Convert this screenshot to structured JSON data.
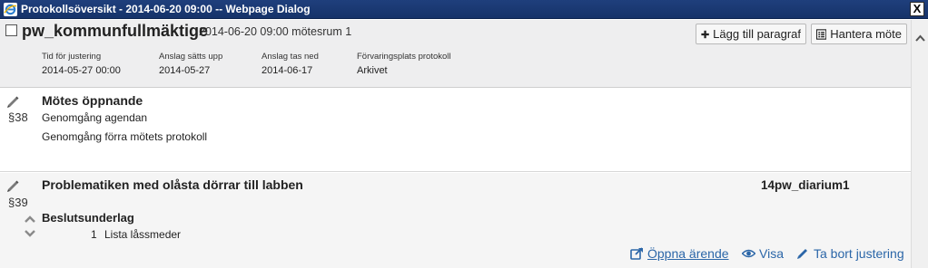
{
  "window": {
    "title": "Protokollsöversikt - 2014-06-20 09:00 -- Webpage Dialog",
    "close_label": "X"
  },
  "header": {
    "title": "pw_kommunfullmäktige",
    "subtitle": "2014-06-20 09:00 mötesrum 1",
    "buttons": {
      "add_paragraph": "Lägg till paragraf",
      "manage_meeting": "Hantera möte"
    },
    "meta": [
      {
        "label": "Tid för justering",
        "value": "2014-05-27 00:00"
      },
      {
        "label": "Anslag sätts upp",
        "value": "2014-05-27"
      },
      {
        "label": "Anslag tas ned",
        "value": "2014-06-17"
      },
      {
        "label": "Förvaringsplats protokoll",
        "value": "Arkivet"
      }
    ]
  },
  "items": [
    {
      "number": "§38",
      "title": "Mötes öppnande",
      "lines": [
        "Genomgång agendan",
        "Genomgång förra mötets protokoll"
      ]
    },
    {
      "number": "§39",
      "title": "Problematiken med olåsta dörrar till labben",
      "diarium": "14pw_diarium1",
      "section_title": "Beslutsunderlag",
      "documents": [
        {
          "num": "1",
          "name": "Lista låssmeder"
        }
      ],
      "actions": {
        "open_case": "Öppna ärende",
        "show": "Visa",
        "remove_adjustment": "Ta bort justering"
      }
    }
  ],
  "colors": {
    "titlebar": "#1f3f7c",
    "link": "#2b66a8",
    "header_bg": "#eeeeef",
    "section2_bg": "#f5f5f5"
  },
  "icons": {
    "app": "ie-app-icon",
    "add": "plus-icon",
    "manage": "list-icon",
    "edit": "pencil-icon",
    "open": "external-link-icon",
    "view": "eye-icon",
    "remove": "pencil-icon"
  }
}
